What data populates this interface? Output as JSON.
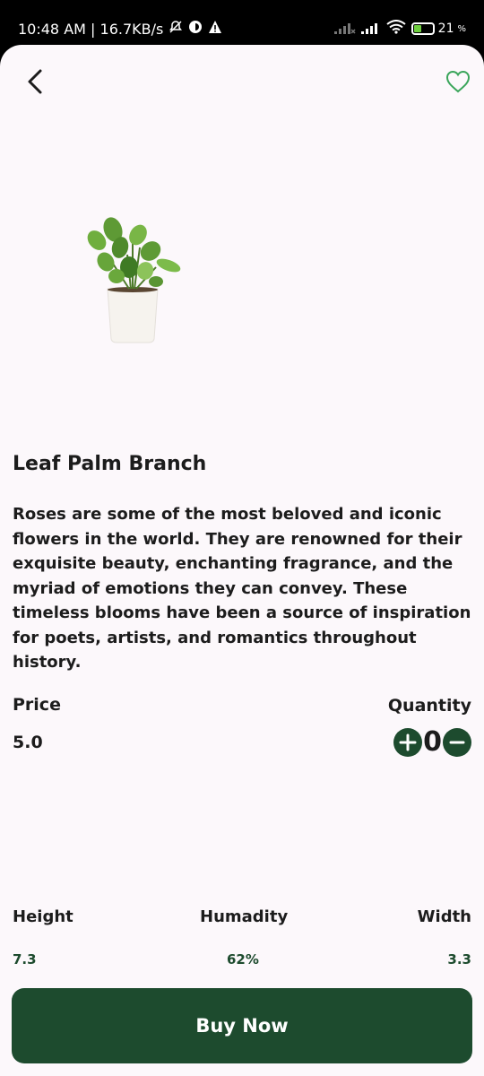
{
  "status_bar": {
    "time_network": "10:48 AM | 16.7KB/s",
    "battery_percent": "21",
    "battery_suffix": "%"
  },
  "header": {
    "back_icon": "chevron-left-icon",
    "favorite_icon": "heart-outline-icon"
  },
  "product": {
    "title": "Leaf Palm Branch",
    "description": "Roses are some of the most beloved and iconic flowers in the world. They are renowned for their exquisite beauty, enchanting fragrance, and the myriad of emotions they can convey. These timeless blooms have been a source of inspiration for poets, artists, and romantics throughout history.",
    "price_label": "Price",
    "price_value": "5.0",
    "quantity_label": "Quantity",
    "quantity_value": "0"
  },
  "specs": {
    "height_label": "Height",
    "height_value": "7.3",
    "humidity_label": "Humadity",
    "humidity_value": "62%",
    "width_label": "Width",
    "width_value": "3.3"
  },
  "actions": {
    "buy_label": "Buy Now"
  },
  "colors": {
    "primary": "#1d4b2e",
    "background": "#fcf8fb",
    "favorite_outline": "#3aa55a"
  }
}
